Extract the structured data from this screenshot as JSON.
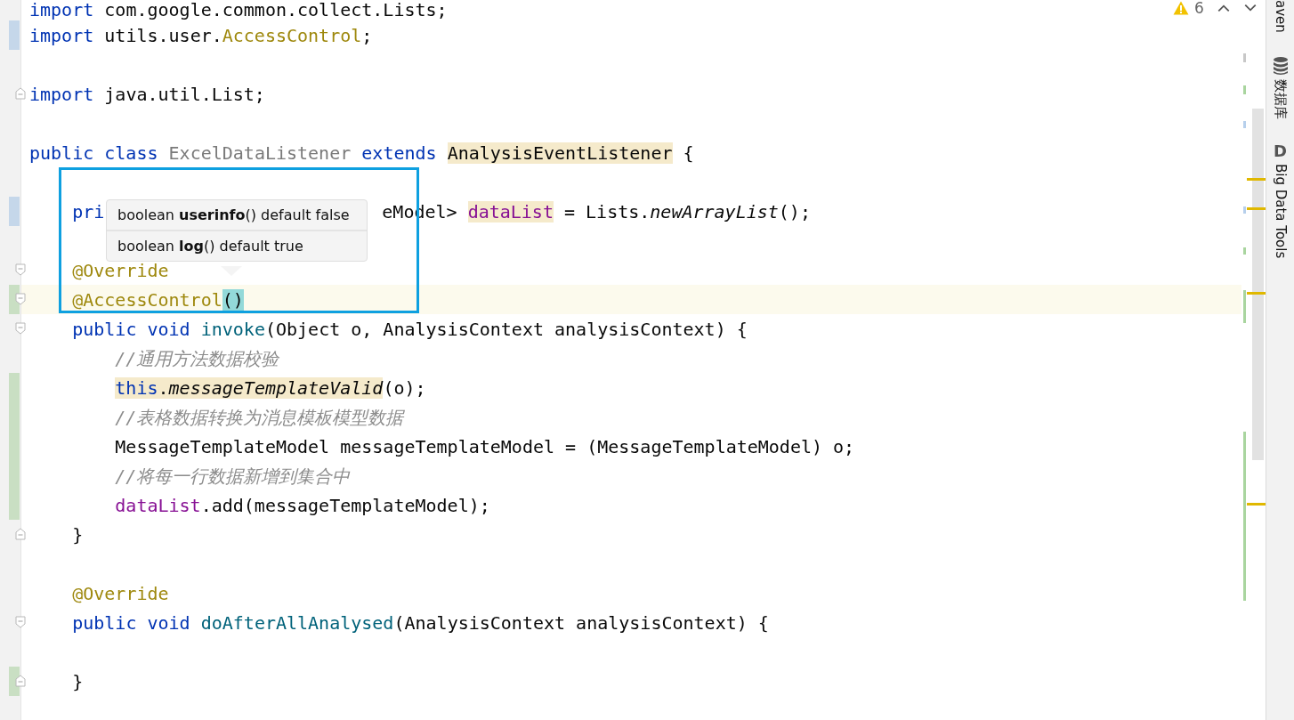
{
  "editor": {
    "lines": [
      {
        "fold_start": false,
        "fold_end": false,
        "current": false,
        "tokens": [
          {
            "text": "import ",
            "kind": "kw"
          },
          {
            "text": "com.google.common.collect.Lists;",
            "kind": "plain"
          }
        ]
      },
      {
        "color": "#c5d7ea",
        "fold_start": false,
        "fold_end": false,
        "current": false,
        "tokens": [
          {
            "text": "import ",
            "kind": "kw"
          },
          {
            "text": "utils.user.",
            "kind": "plain"
          },
          {
            "text": "AccessControl",
            "kind": "anno"
          },
          {
            "text": ";",
            "kind": "plain"
          }
        ]
      },
      {
        "fold_start": false,
        "fold_end": false,
        "current": false
      },
      {
        "fold_start": false,
        "fold_end": true,
        "current": false,
        "tokens": [
          {
            "text": "import ",
            "kind": "kw"
          },
          {
            "text": "java.util.List;",
            "kind": "plain"
          }
        ]
      },
      {
        "fold_start": false,
        "fold_end": false,
        "current": false
      },
      {
        "fold_start": false,
        "fold_end": false,
        "current": false,
        "tokens": [
          {
            "text": "public class ",
            "kind": "kw"
          },
          {
            "text": "ExcelDataListener ",
            "kind": "unused"
          },
          {
            "text": "extends ",
            "kind": "kw"
          },
          {
            "text": "AnalysisEventListener",
            "kind": "plain-usage"
          },
          {
            "text": " {",
            "kind": "plain"
          }
        ]
      },
      {
        "fold_start": false,
        "fold_end": false,
        "current": false
      },
      {
        "color": "#c5d7ea",
        "fold_start": false,
        "fold_end": false,
        "current": false,
        "tokens": [
          {
            "text": "    pri",
            "kind": "kw"
          },
          {
            "kind": "covered"
          },
          {
            "text": "eModel> ",
            "kind": "plain"
          },
          {
            "text": "dataList",
            "kind": "field-usage"
          },
          {
            "text": " = Lists.",
            "kind": "plain"
          },
          {
            "text": "newArrayList",
            "kind": "italic"
          },
          {
            "text": "();",
            "kind": "plain"
          }
        ]
      },
      {
        "fold_start": false,
        "fold_end": false,
        "current": false
      },
      {
        "fold_start": true,
        "fold_end": false,
        "current": false,
        "tokens": [
          {
            "text": "    @Override",
            "kind": "anno"
          }
        ]
      },
      {
        "color": "#c9dfc3",
        "fold_start": true,
        "fold_end": false,
        "current": true,
        "tokens": [
          {
            "text": "    @AccessControl",
            "kind": "anno"
          },
          {
            "text": "()",
            "kind": "brace-match"
          }
        ]
      },
      {
        "fold_start": true,
        "fold_end": false,
        "current": false,
        "tokens": [
          {
            "text": "    public void ",
            "kind": "kw"
          },
          {
            "text": "invoke",
            "kind": "decl"
          },
          {
            "text": "(Object o, AnalysisContext analysisContext) {",
            "kind": "plain"
          }
        ]
      },
      {
        "fold_start": false,
        "fold_end": false,
        "current": false,
        "tokens": [
          {
            "text": "        //通用方法数据校验",
            "kind": "comment"
          }
        ]
      },
      {
        "color": "#c9dfc3",
        "fold_start": false,
        "fold_end": false,
        "current": false,
        "tokens": [
          {
            "text": "        this",
            "kind": "kw-usage"
          },
          {
            "text": ".",
            "kind": "plain-usage"
          },
          {
            "text": "messageTemplateValid",
            "kind": "italic-usage"
          },
          {
            "text": "(o);",
            "kind": "plain"
          }
        ]
      },
      {
        "color": "#c9dfc3",
        "fold_start": false,
        "fold_end": false,
        "current": false,
        "tokens": [
          {
            "text": "        //表格数据转换为消息模板模型数据",
            "kind": "comment"
          }
        ]
      },
      {
        "color": "#c9dfc3",
        "fold_start": false,
        "fold_end": false,
        "current": false,
        "tokens": [
          {
            "text": "        MessageTemplateModel messageTemplateModel = (MessageTemplateModel) o;",
            "kind": "plain"
          }
        ]
      },
      {
        "color": "#c9dfc3",
        "fold_start": false,
        "fold_end": false,
        "current": false,
        "tokens": [
          {
            "text": "        //将每一行数据新增到集合中",
            "kind": "comment"
          }
        ]
      },
      {
        "color": "#c9dfc3",
        "fold_start": false,
        "fold_end": false,
        "current": false,
        "tokens": [
          {
            "text": "        dataList",
            "kind": "field"
          },
          {
            "text": ".add(messageTemplateModel);",
            "kind": "plain"
          }
        ]
      },
      {
        "fold_start": false,
        "fold_end": true,
        "current": false,
        "tokens": [
          {
            "text": "    }",
            "kind": "plain"
          }
        ]
      },
      {
        "fold_start": false,
        "fold_end": false,
        "current": false
      },
      {
        "fold_start": false,
        "fold_end": false,
        "current": false,
        "tokens": [
          {
            "text": "    @Override",
            "kind": "anno"
          }
        ]
      },
      {
        "fold_start": true,
        "fold_end": false,
        "current": false,
        "tokens": [
          {
            "text": "    public void ",
            "kind": "kw"
          },
          {
            "text": "doAfterAllAnalysed",
            "kind": "decl"
          },
          {
            "text": "(AnalysisContext analysisContext) {",
            "kind": "plain"
          }
        ]
      },
      {
        "fold_start": false,
        "fold_end": false,
        "current": false
      },
      {
        "color": "#c9dfc3",
        "fold_start": false,
        "fold_end": true,
        "current": false,
        "tokens": [
          {
            "text": "    }",
            "kind": "plain"
          }
        ]
      },
      {
        "fold_start": false,
        "fold_end": false,
        "current": false
      }
    ]
  },
  "popup": {
    "items": [
      {
        "text": "boolean **userinfo**() default false"
      },
      {
        "text": "boolean **log**() default true"
      }
    ]
  },
  "warnings": {
    "count": "6"
  },
  "tool_windows": [
    {
      "label": "aven",
      "kind": "plain"
    },
    {
      "label": "数据库",
      "kind": "database"
    },
    {
      "label": "Big Data Tools",
      "kind": "letter",
      "glyph": "D"
    }
  ]
}
